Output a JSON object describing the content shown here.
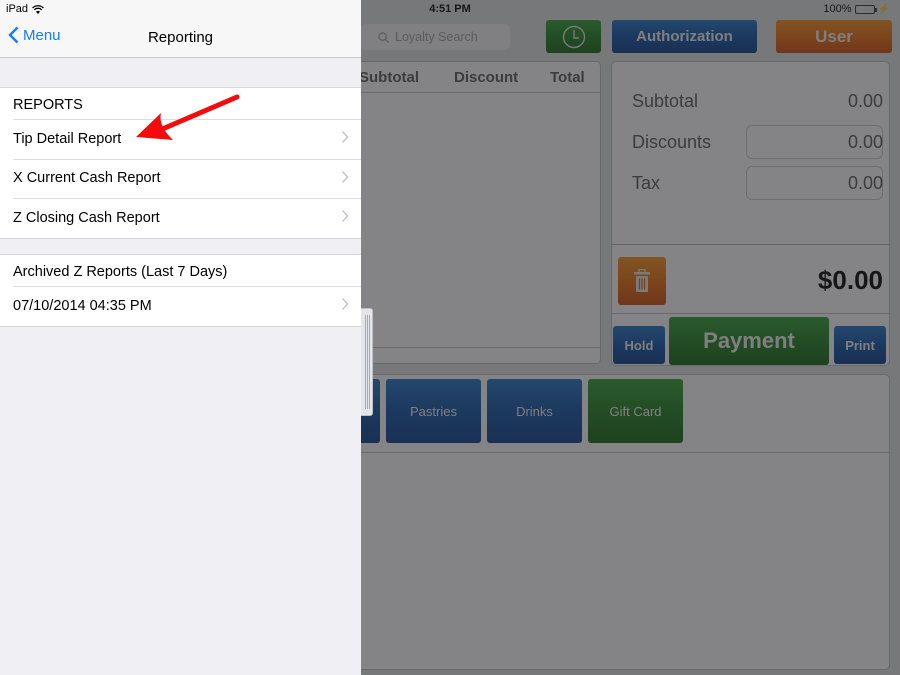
{
  "status_bar": {
    "device": "iPad",
    "time": "4:51 PM",
    "battery_text": "100%",
    "battery_level": 1.0
  },
  "menu": {
    "back_label": "Menu",
    "title": "Reporting",
    "reports_header": "REPORTS",
    "reports": [
      {
        "label": "Tip Detail Report"
      },
      {
        "label": "X Current Cash Report"
      },
      {
        "label": "Z Closing Cash Report"
      }
    ],
    "archived_header": "Archived Z Reports (Last 7 Days)",
    "archived": [
      {
        "label": "07/10/2014 04:35 PM"
      }
    ]
  },
  "annotation": {
    "arrow_color": "#f40c0c",
    "points_to": "Tip Detail Report"
  },
  "pos": {
    "loyalty_search_placeholder": "Loyalty Search",
    "authorization_label": "Authorization",
    "user_label": "User",
    "order_columns": [
      "Subtotal",
      "Discount",
      "Total"
    ],
    "totals": {
      "subtotal_label": "Subtotal",
      "subtotal_value": "0.00",
      "discounts_label": "Discounts",
      "discounts_value": "0.00",
      "tax_label": "Tax",
      "tax_value": "0.00",
      "grand_total": "$0.00"
    },
    "hold_label": "Hold",
    "payment_label": "Payment",
    "print_label": "Print",
    "categories": [
      {
        "label": "s",
        "color": "blue"
      },
      {
        "label": "Pastries",
        "color": "blue"
      },
      {
        "label": "Drinks",
        "color": "blue"
      },
      {
        "label": "Gift Card",
        "color": "green"
      }
    ]
  }
}
